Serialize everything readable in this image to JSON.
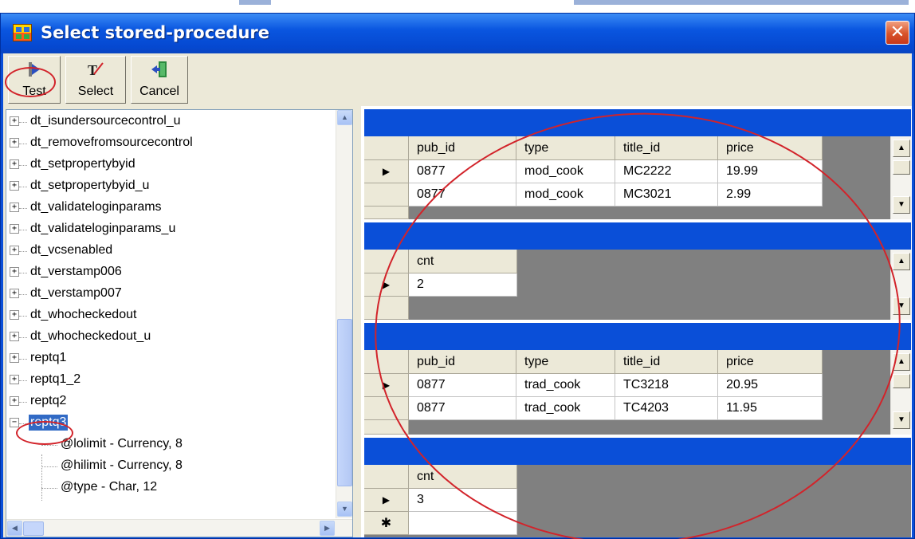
{
  "window": {
    "title": "Select stored-procedure",
    "close_glyph": "✕"
  },
  "toolbar": {
    "buttons": [
      {
        "label": "Test",
        "icon": "run-icon"
      },
      {
        "label": "Select",
        "icon": "select-icon"
      },
      {
        "label": "Cancel",
        "icon": "exit-door-icon"
      }
    ]
  },
  "tree": {
    "nodes": [
      {
        "label": "dt_isundersourcecontrol_u",
        "expander": "+"
      },
      {
        "label": "dt_removefromsourcecontrol",
        "expander": "+"
      },
      {
        "label": "dt_setpropertybyid",
        "expander": "+"
      },
      {
        "label": "dt_setpropertybyid_u",
        "expander": "+"
      },
      {
        "label": "dt_validateloginparams",
        "expander": "+"
      },
      {
        "label": "dt_validateloginparams_u",
        "expander": "+"
      },
      {
        "label": "dt_vcsenabled",
        "expander": "+"
      },
      {
        "label": "dt_verstamp006",
        "expander": "+"
      },
      {
        "label": "dt_verstamp007",
        "expander": "+"
      },
      {
        "label": "dt_whocheckedout",
        "expander": "+"
      },
      {
        "label": "dt_whocheckedout_u",
        "expander": "+"
      },
      {
        "label": "reptq1",
        "expander": "+"
      },
      {
        "label": "reptq1_2",
        "expander": "+"
      },
      {
        "label": "reptq2",
        "expander": "+"
      },
      {
        "label": "reptq3",
        "expander": "−",
        "selected": true
      }
    ],
    "children": [
      {
        "label": "@lolimit - Currency, 8"
      },
      {
        "label": "@hilimit - Currency, 8"
      },
      {
        "label": "@type - Char, 12"
      }
    ]
  },
  "results": {
    "grid1": {
      "columns": [
        "pub_id",
        "type",
        "title_id",
        "price"
      ],
      "rows": [
        [
          "0877",
          "mod_cook",
          "MC2222",
          "19.99"
        ],
        [
          "0877",
          "mod_cook",
          "MC3021",
          "2.99"
        ]
      ]
    },
    "grid2": {
      "columns": [
        "cnt"
      ],
      "rows": [
        [
          "2"
        ]
      ]
    },
    "grid3": {
      "columns": [
        "pub_id",
        "type",
        "title_id",
        "price"
      ],
      "rows": [
        [
          "0877",
          "trad_cook",
          "TC3218",
          "20.95"
        ],
        [
          "0877",
          "trad_cook",
          "TC4203",
          "11.95"
        ]
      ]
    },
    "grid4": {
      "columns": [
        "cnt"
      ],
      "rows": [
        [
          "3"
        ]
      ],
      "new_row_marker": "✱"
    }
  },
  "colors": {
    "titlebar": "#0a4fd8",
    "selection": "#316ac5",
    "annotation": "#d2232a"
  }
}
